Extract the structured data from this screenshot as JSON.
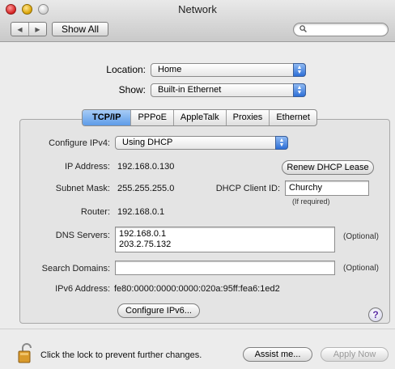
{
  "window": {
    "title": "Network"
  },
  "toolbar": {
    "back_glyph": "◀",
    "forward_glyph": "▶",
    "show_all_label": "Show All",
    "search_placeholder": ""
  },
  "location": {
    "label": "Location:",
    "value": "Home"
  },
  "show": {
    "label": "Show:",
    "value": "Built-in Ethernet"
  },
  "tabs": [
    {
      "label": "TCP/IP",
      "selected": true
    },
    {
      "label": "PPPoE"
    },
    {
      "label": "AppleTalk"
    },
    {
      "label": "Proxies"
    },
    {
      "label": "Ethernet"
    }
  ],
  "tcpip": {
    "configure_label": "Configure IPv4:",
    "configure_value": "Using DHCP",
    "ip_label": "IP Address:",
    "ip_value": "192.168.0.130",
    "renew_label": "Renew DHCP Lease",
    "subnet_label": "Subnet Mask:",
    "subnet_value": "255.255.255.0",
    "client_id_label": "DHCP Client ID:",
    "client_id_value": "Churchy",
    "client_id_note": "(If required)",
    "router_label": "Router:",
    "router_value": "192.168.0.1",
    "dns_label": "DNS Servers:",
    "dns_values": [
      "192.168.0.1",
      "203.2.75.132"
    ],
    "dns_optional": "(Optional)",
    "search_label": "Search Domains:",
    "search_value": "",
    "search_optional": "(Optional)",
    "ipv6_label": "IPv6 Address:",
    "ipv6_value": "fe80:0000:0000:0000:020a:95ff:fea6:1ed2",
    "configure_ipv6_label": "Configure IPv6...",
    "help_glyph": "?"
  },
  "footer": {
    "lock_text": "Click the lock to prevent further changes.",
    "assist_label": "Assist me...",
    "apply_label": "Apply Now",
    "apply_enabled": false
  }
}
